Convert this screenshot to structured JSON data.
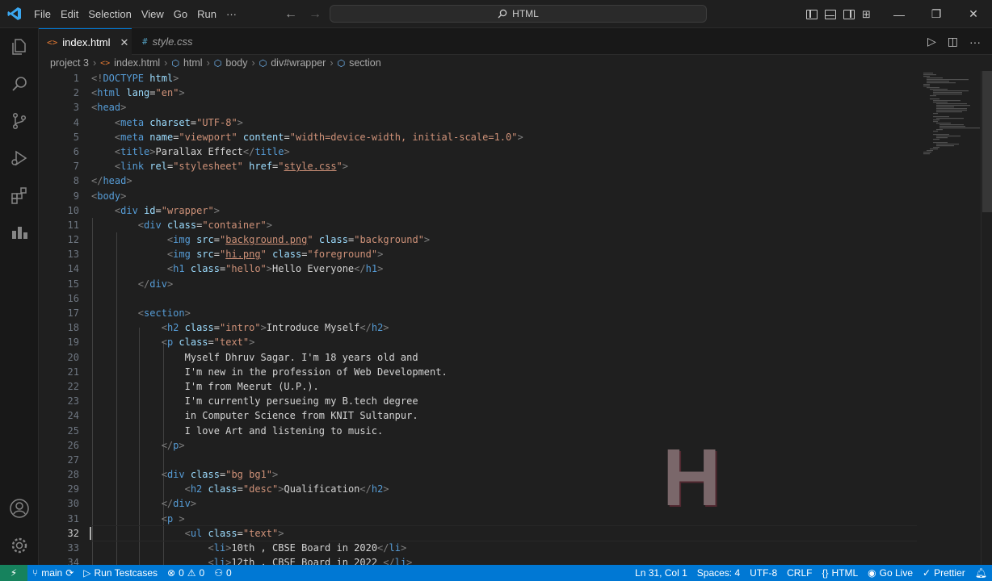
{
  "titlebar": {
    "menus": [
      "File",
      "Edit",
      "Selection",
      "View",
      "Go",
      "Run",
      "···"
    ],
    "search_text": "HTML",
    "icons": [
      "vscode-logo-icon",
      "arrow-left-icon",
      "arrow-right-icon",
      "search-icon"
    ]
  },
  "tabs": [
    {
      "label": "index.html",
      "icon": "<>",
      "active": true
    },
    {
      "label": "style.css",
      "icon": "#",
      "active": false
    }
  ],
  "breadcrumb": {
    "items": [
      "project 3",
      "index.html",
      "html",
      "body",
      "div#wrapper",
      "section"
    ]
  },
  "editor": {
    "current_line": 32,
    "lines": [
      [
        [
          "t",
          "<!"
        ],
        [
          "n",
          "DOCTYPE"
        ],
        [
          "txt",
          " "
        ],
        [
          "a",
          "html"
        ],
        [
          "t",
          ">"
        ]
      ],
      [
        [
          "t",
          "<"
        ],
        [
          "n",
          "html"
        ],
        [
          "txt",
          " "
        ],
        [
          "a",
          "lang"
        ],
        [
          "txt",
          "="
        ],
        [
          "s",
          "\"en\""
        ],
        [
          "t",
          ">"
        ]
      ],
      [
        [
          "t",
          "<"
        ],
        [
          "n",
          "head"
        ],
        [
          "t",
          ">"
        ]
      ],
      [
        [
          "txt",
          "    "
        ],
        [
          "t",
          "<"
        ],
        [
          "n",
          "meta"
        ],
        [
          "txt",
          " "
        ],
        [
          "a",
          "charset"
        ],
        [
          "txt",
          "="
        ],
        [
          "s",
          "\"UTF-8\""
        ],
        [
          "t",
          ">"
        ]
      ],
      [
        [
          "txt",
          "    "
        ],
        [
          "t",
          "<"
        ],
        [
          "n",
          "meta"
        ],
        [
          "txt",
          " "
        ],
        [
          "a",
          "name"
        ],
        [
          "txt",
          "="
        ],
        [
          "s",
          "\"viewport\""
        ],
        [
          "txt",
          " "
        ],
        [
          "a",
          "content"
        ],
        [
          "txt",
          "="
        ],
        [
          "s",
          "\"width=device-width, initial-scale=1.0\""
        ],
        [
          "t",
          ">"
        ]
      ],
      [
        [
          "txt",
          "    "
        ],
        [
          "t",
          "<"
        ],
        [
          "n",
          "title"
        ],
        [
          "t",
          ">"
        ],
        [
          "txt",
          "Parallax Effect"
        ],
        [
          "t",
          "</"
        ],
        [
          "n",
          "title"
        ],
        [
          "t",
          ">"
        ]
      ],
      [
        [
          "txt",
          "    "
        ],
        [
          "t",
          "<"
        ],
        [
          "n",
          "link"
        ],
        [
          "txt",
          " "
        ],
        [
          "a",
          "rel"
        ],
        [
          "txt",
          "="
        ],
        [
          "s",
          "\"stylesheet\""
        ],
        [
          "txt",
          " "
        ],
        [
          "a",
          "href"
        ],
        [
          "txt",
          "="
        ],
        [
          "s",
          "\""
        ],
        [
          "u",
          "style.css"
        ],
        [
          "s",
          "\""
        ],
        [
          "t",
          ">"
        ]
      ],
      [
        [
          "t",
          "</"
        ],
        [
          "n",
          "head"
        ],
        [
          "t",
          ">"
        ]
      ],
      [
        [
          "t",
          "<"
        ],
        [
          "n",
          "body"
        ],
        [
          "t",
          ">"
        ]
      ],
      [
        [
          "txt",
          "    "
        ],
        [
          "t",
          "<"
        ],
        [
          "n",
          "div"
        ],
        [
          "txt",
          " "
        ],
        [
          "a",
          "id"
        ],
        [
          "txt",
          "="
        ],
        [
          "s",
          "\"wrapper\""
        ],
        [
          "t",
          ">"
        ]
      ],
      [
        [
          "txt",
          "        "
        ],
        [
          "t",
          "<"
        ],
        [
          "n",
          "div"
        ],
        [
          "txt",
          " "
        ],
        [
          "a",
          "class"
        ],
        [
          "txt",
          "="
        ],
        [
          "s",
          "\"container\""
        ],
        [
          "t",
          ">"
        ]
      ],
      [
        [
          "txt",
          "             "
        ],
        [
          "t",
          "<"
        ],
        [
          "n",
          "img"
        ],
        [
          "txt",
          " "
        ],
        [
          "a",
          "src"
        ],
        [
          "txt",
          "="
        ],
        [
          "s",
          "\""
        ],
        [
          "u",
          "background.png"
        ],
        [
          "s",
          "\""
        ],
        [
          "txt",
          " "
        ],
        [
          "a",
          "class"
        ],
        [
          "txt",
          "="
        ],
        [
          "s",
          "\"background\""
        ],
        [
          "t",
          ">"
        ]
      ],
      [
        [
          "txt",
          "             "
        ],
        [
          "t",
          "<"
        ],
        [
          "n",
          "img"
        ],
        [
          "txt",
          " "
        ],
        [
          "a",
          "src"
        ],
        [
          "txt",
          "="
        ],
        [
          "s",
          "\""
        ],
        [
          "u",
          "hi.png"
        ],
        [
          "s",
          "\""
        ],
        [
          "txt",
          " "
        ],
        [
          "a",
          "class"
        ],
        [
          "txt",
          "="
        ],
        [
          "s",
          "\"foreground\""
        ],
        [
          "t",
          ">"
        ]
      ],
      [
        [
          "txt",
          "             "
        ],
        [
          "t",
          "<"
        ],
        [
          "n",
          "h1"
        ],
        [
          "txt",
          " "
        ],
        [
          "a",
          "class"
        ],
        [
          "txt",
          "="
        ],
        [
          "s",
          "\"hello\""
        ],
        [
          "t",
          ">"
        ],
        [
          "txt",
          "Hello Everyone"
        ],
        [
          "t",
          "</"
        ],
        [
          "n",
          "h1"
        ],
        [
          "t",
          ">"
        ]
      ],
      [
        [
          "txt",
          "        "
        ],
        [
          "t",
          "</"
        ],
        [
          "n",
          "div"
        ],
        [
          "t",
          ">"
        ]
      ],
      [],
      [
        [
          "txt",
          "        "
        ],
        [
          "t",
          "<"
        ],
        [
          "n",
          "section"
        ],
        [
          "t",
          ">"
        ]
      ],
      [
        [
          "txt",
          "            "
        ],
        [
          "t",
          "<"
        ],
        [
          "n",
          "h2"
        ],
        [
          "txt",
          " "
        ],
        [
          "a",
          "class"
        ],
        [
          "txt",
          "="
        ],
        [
          "s",
          "\"intro\""
        ],
        [
          "t",
          ">"
        ],
        [
          "txt",
          "Introduce Myself"
        ],
        [
          "t",
          "</"
        ],
        [
          "n",
          "h2"
        ],
        [
          "t",
          ">"
        ]
      ],
      [
        [
          "txt",
          "            "
        ],
        [
          "t",
          "<"
        ],
        [
          "n",
          "p"
        ],
        [
          "txt",
          " "
        ],
        [
          "a",
          "class"
        ],
        [
          "txt",
          "="
        ],
        [
          "s",
          "\"text\""
        ],
        [
          "t",
          ">"
        ]
      ],
      [
        [
          "txt",
          "                Myself Dhruv Sagar. I'm 18 years old and"
        ]
      ],
      [
        [
          "txt",
          "                I'm new in the profession of Web Development."
        ]
      ],
      [
        [
          "txt",
          "                I'm from Meerut (U.P.)."
        ]
      ],
      [
        [
          "txt",
          "                I'm currently persueing my B.tech degree"
        ]
      ],
      [
        [
          "txt",
          "                in Computer Science from KNIT Sultanpur."
        ]
      ],
      [
        [
          "txt",
          "                I love Art and listening to music."
        ]
      ],
      [
        [
          "txt",
          "            "
        ],
        [
          "t",
          "</"
        ],
        [
          "n",
          "p"
        ],
        [
          "t",
          ">"
        ]
      ],
      [],
      [
        [
          "txt",
          "            "
        ],
        [
          "t",
          "<"
        ],
        [
          "n",
          "div"
        ],
        [
          "txt",
          " "
        ],
        [
          "a",
          "class"
        ],
        [
          "txt",
          "="
        ],
        [
          "s",
          "\"bg bg1\""
        ],
        [
          "t",
          ">"
        ]
      ],
      [
        [
          "txt",
          "                "
        ],
        [
          "t",
          "<"
        ],
        [
          "n",
          "h2"
        ],
        [
          "txt",
          " "
        ],
        [
          "a",
          "class"
        ],
        [
          "txt",
          "="
        ],
        [
          "s",
          "\"desc\""
        ],
        [
          "t",
          ">"
        ],
        [
          "txt",
          "Qualification"
        ],
        [
          "t",
          "</"
        ],
        [
          "n",
          "h2"
        ],
        [
          "t",
          ">"
        ]
      ],
      [
        [
          "txt",
          "            "
        ],
        [
          "t",
          "</"
        ],
        [
          "n",
          "div"
        ],
        [
          "t",
          ">"
        ]
      ],
      [
        [
          "txt",
          "            "
        ],
        [
          "t",
          "<"
        ],
        [
          "n",
          "p"
        ],
        [
          "txt",
          " "
        ],
        [
          "t",
          ">"
        ]
      ],
      [
        [
          "txt",
          "                "
        ],
        [
          "t",
          "<"
        ],
        [
          "n",
          "ul"
        ],
        [
          "txt",
          " "
        ],
        [
          "a",
          "class"
        ],
        [
          "txt",
          "="
        ],
        [
          "s",
          "\"text\""
        ],
        [
          "t",
          ">"
        ]
      ],
      [
        [
          "txt",
          "                    "
        ],
        [
          "t",
          "<"
        ],
        [
          "n",
          "li"
        ],
        [
          "t",
          ">"
        ],
        [
          "txt",
          "10th , CBSE Board in 2020"
        ],
        [
          "t",
          "</"
        ],
        [
          "n",
          "li"
        ],
        [
          "t",
          ">"
        ]
      ],
      [
        [
          "txt",
          "                    "
        ],
        [
          "t",
          "<"
        ],
        [
          "n",
          "li"
        ],
        [
          "t",
          ">"
        ],
        [
          "txt",
          "12th , CBSE Board in 2022 "
        ],
        [
          "t",
          "</"
        ],
        [
          "n",
          "li"
        ],
        [
          "t",
          ">"
        ]
      ]
    ]
  },
  "watermark": "H",
  "statusbar": {
    "branch": "main",
    "run_testcases": "Run Testcases",
    "errors": "0",
    "warnings": "0",
    "ports": "0",
    "cursor": "Ln 31, Col 1",
    "spaces": "Spaces: 4",
    "encoding": "UTF-8",
    "eol": "CRLF",
    "language": "HTML",
    "go_live": "Go Live",
    "prettier": "Prettier"
  },
  "colors": {
    "statusbar": "#0078d4",
    "remote": "#16825d",
    "tag": "#569cd6",
    "attr": "#9cdcfe",
    "string": "#ce9178",
    "bracket": "#808080"
  }
}
